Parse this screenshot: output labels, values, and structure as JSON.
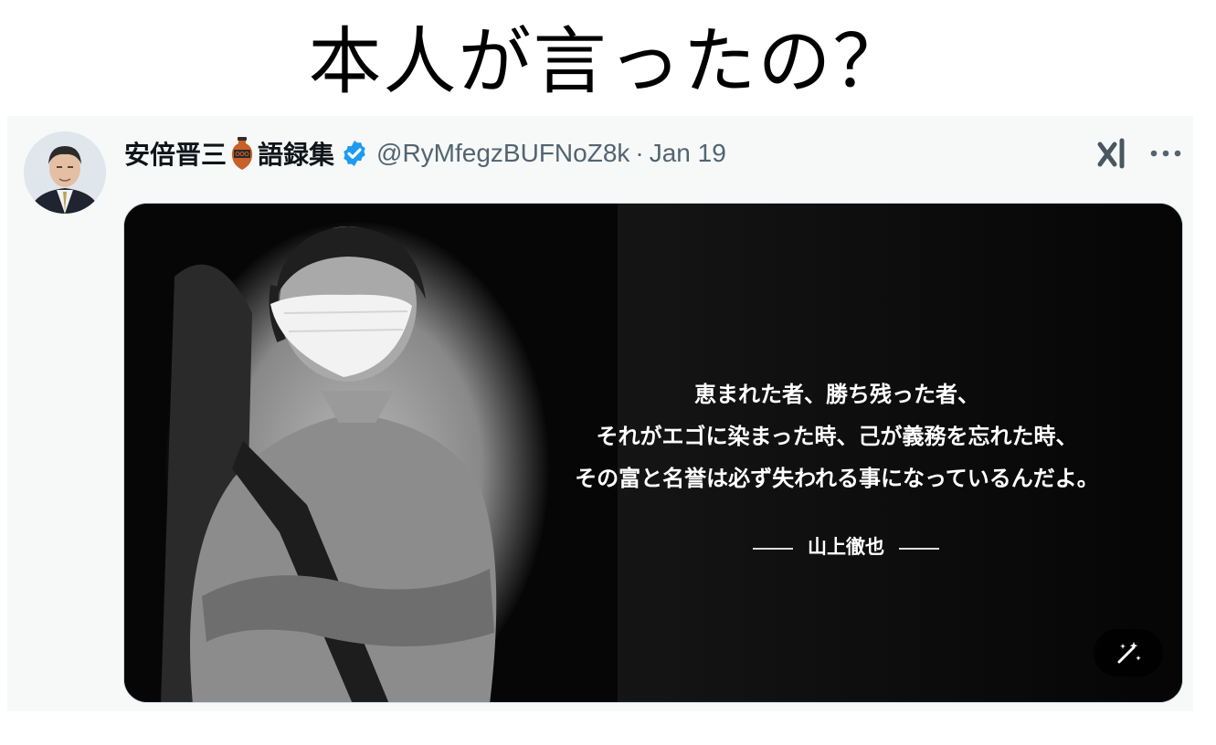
{
  "headline": "本人が言ったの？",
  "tweet": {
    "display_name": "安倍晋三",
    "name_suffix": "語録集",
    "handle": "@RyMfegzBUFNoZ8k",
    "separator": "·",
    "date": "Jan 19",
    "verified": true,
    "accent_color": "#1d9bf0"
  },
  "media": {
    "quote_lines": [
      "恵まれた者、勝ち残った者、",
      "それがエゴに染まった時、己が義務を忘れた時、",
      "その富と名誉は必ず失われる事になっているんだよ。"
    ],
    "attribution": "山上徹也"
  },
  "icons": {
    "vase": "amphora-emoji-icon",
    "verified": "verified-badge-icon",
    "grok": "grok-icon",
    "more": "more-icon",
    "magic": "magic-wand-icon"
  }
}
